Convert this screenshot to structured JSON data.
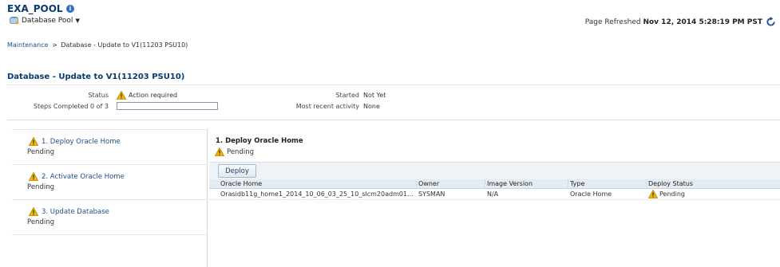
{
  "header": {
    "title": "EXA_POOL",
    "menu_label": "Database Pool",
    "refreshed_prefix": "Page Refreshed",
    "refreshed_time": "Nov 12, 2014 5:28:19 PM PST"
  },
  "breadcrumb": {
    "link": "Maintenance",
    "separator": ">",
    "current": "Database - Update to V1(11203 PSU10)"
  },
  "summary": {
    "title": "Database - Update to V1(11203 PSU10)",
    "status_label": "Status",
    "status_value": "Action required",
    "steps_label": "Steps Completed 0 of 3",
    "steps_progress": 0,
    "started_label": "Started",
    "started_value": "Not Yet",
    "recent_label": "Most recent activity",
    "recent_value": "None"
  },
  "steps": [
    {
      "label": "1. Deploy Oracle Home",
      "state": "Pending"
    },
    {
      "label": "2. Activate Oracle Home",
      "state": "Pending"
    },
    {
      "label": "3. Update Database",
      "state": "Pending"
    }
  ],
  "detail": {
    "title": "1. Deploy Oracle Home",
    "status": "Pending",
    "deploy_button": "Deploy",
    "columns": [
      "Oracle Home",
      "Owner",
      "Image Version",
      "Type",
      "Deploy Status"
    ],
    "rows": [
      {
        "oracle_home": "Orasidb11g_home1_2014_10_06_03_25_10_slcm20adm01...",
        "owner": "SYSMAN",
        "image_version": "N/A",
        "type": "Oracle Home",
        "deploy_status": "Pending"
      }
    ]
  },
  "colors": {
    "title_blue": "#0b3a6e",
    "link_blue": "#1f4f8a",
    "warning_yellow": "#f5b800",
    "toolbar_bg": "#eef3f7"
  },
  "icons": {
    "info": "info-icon",
    "warning": "warning-icon",
    "refresh": "refresh-icon",
    "pool": "database-pool-icon"
  }
}
